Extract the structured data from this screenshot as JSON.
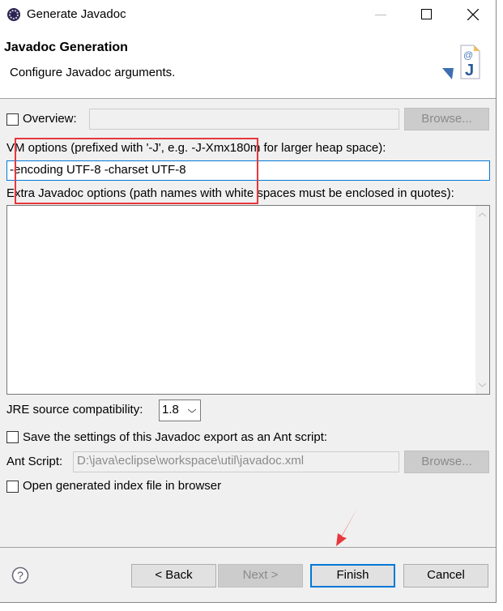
{
  "window": {
    "title": "Generate Javadoc",
    "app_icon": "eclipse-icon",
    "controls": [
      "minimize-icon",
      "maximize-icon",
      "close-icon"
    ]
  },
  "header": {
    "title": "Javadoc Generation",
    "subtitle": "Configure Javadoc arguments.",
    "icon": "javadoc-wizard-icon"
  },
  "overview": {
    "label": "Overview:",
    "checked": false,
    "value": "",
    "browse_label": "Browse..."
  },
  "vm_options": {
    "label": "VM options (prefixed with '-J', e.g. -J-Xmx180m for larger heap space):",
    "value": "-encoding UTF-8 -charset UTF-8"
  },
  "extra_options": {
    "label": "Extra Javadoc options (path names with white spaces must be enclosed in quotes):",
    "value": ""
  },
  "jre": {
    "label": "JRE source compatibility:",
    "selected": "1.8"
  },
  "ant": {
    "save_label": "Save the settings of this Javadoc export as an Ant script:",
    "checked": false,
    "script_label": "Ant Script:",
    "script_value": "D:\\java\\eclipse\\workspace\\util\\javadoc.xml",
    "browse_label": "Browse..."
  },
  "open_index": {
    "label": "Open generated index file in browser",
    "checked": false
  },
  "footer": {
    "help_icon": "help-icon",
    "back": "< Back",
    "next": "Next >",
    "finish": "Finish",
    "cancel": "Cancel"
  },
  "annotation_color": "#e8373c"
}
